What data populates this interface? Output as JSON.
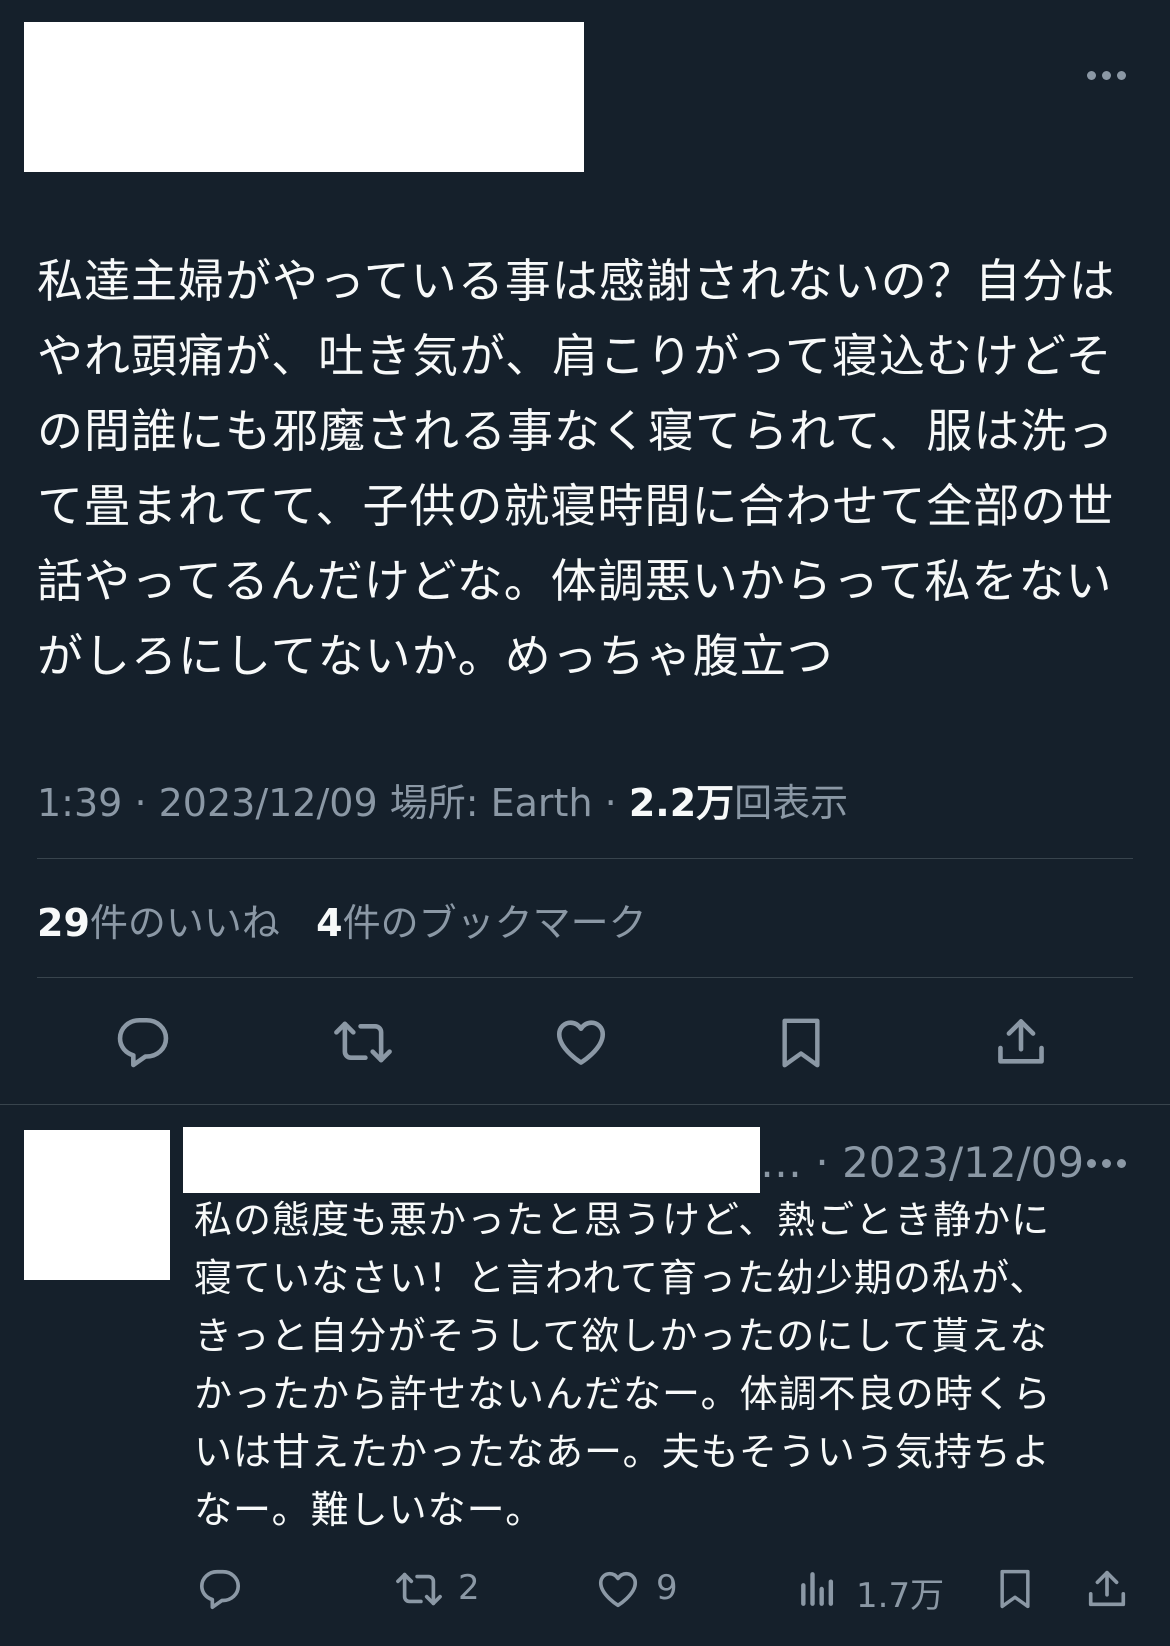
{
  "tweet": {
    "text": "私達主婦がやっている事は感謝されないの？自分は\nやれ頭痛が、吐き気が、肩こりがって寝込むけどそ\nの間誰にも邪魔される事なく寝てられて、服は洗っ\nて畳まれてて、子供の就寝時間に合わせて全部の世\n話やってるんだけどな。体調悪いからって私をない\nがしろにしてないか。めっちゃ腹立つ",
    "time": "1:39",
    "sep": "·",
    "date": "2023/12/09",
    "location": "場所: Earth",
    "views_count": "2.2万",
    "views_label": "回表示",
    "likes_count": "29",
    "likes_label": "件のいいね",
    "bookmarks_count": "4",
    "bookmarks_label": "件のブックマーク"
  },
  "reply": {
    "ellipsis": "…",
    "sep": "·",
    "date": "2023/12/09",
    "text": "私の態度も悪かったと思うけど、熱ごとき静かに\n寝ていなさい！と言われて育った幼少期の私が、\nきっと自分がそうして欲しかったのにして貰えな\nかったから許せないんだなー。体調不良の時くら\nいは甘えたかったなあー。夫もそういう気持ちよ\nなー。難しいなー。",
    "retweets": "2",
    "likes": "9",
    "views": "1.7万"
  },
  "icons": {
    "more": "more-horizontal-icon",
    "reply": "reply-icon",
    "retweet": "retweet-icon",
    "like": "heart-icon",
    "bookmark": "bookmark-icon",
    "share": "share-icon",
    "views": "views-bar-chart-icon"
  },
  "colors": {
    "background": "#15202b",
    "text": "#f7f9f9",
    "secondary": "#8b98a5",
    "divider": "#38444d"
  }
}
